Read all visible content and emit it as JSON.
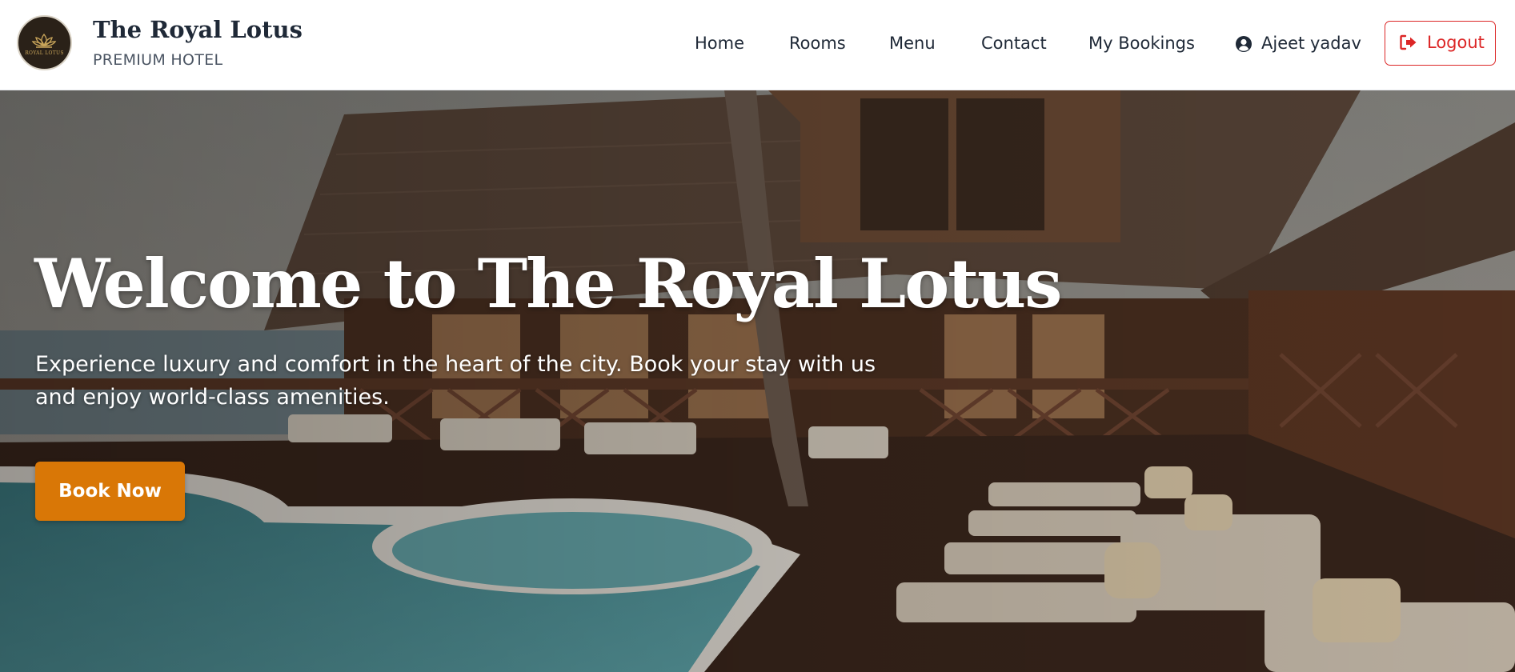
{
  "brand": {
    "title": "The Royal Lotus",
    "subtitle": "PREMIUM HOTEL",
    "logo_text": "ROYAL LOTUS",
    "logo_icon": "lotus-icon"
  },
  "nav": {
    "items": [
      {
        "label": "Home"
      },
      {
        "label": "Rooms"
      },
      {
        "label": "Menu"
      },
      {
        "label": "Contact"
      },
      {
        "label": "My Bookings"
      }
    ],
    "user": {
      "name": "Ajeet yadav",
      "icon": "user-circle-icon"
    },
    "logout": {
      "label": "Logout",
      "icon": "sign-out-icon"
    }
  },
  "hero": {
    "title": "Welcome to The Royal Lotus",
    "description": "Experience luxury and comfort in the heart of the city. Book your stay with us and enjoy world-class amenities.",
    "cta_label": "Book Now"
  },
  "colors": {
    "accent": "#d97706",
    "logout": "#dc2626",
    "text_dark": "#1f2937"
  }
}
